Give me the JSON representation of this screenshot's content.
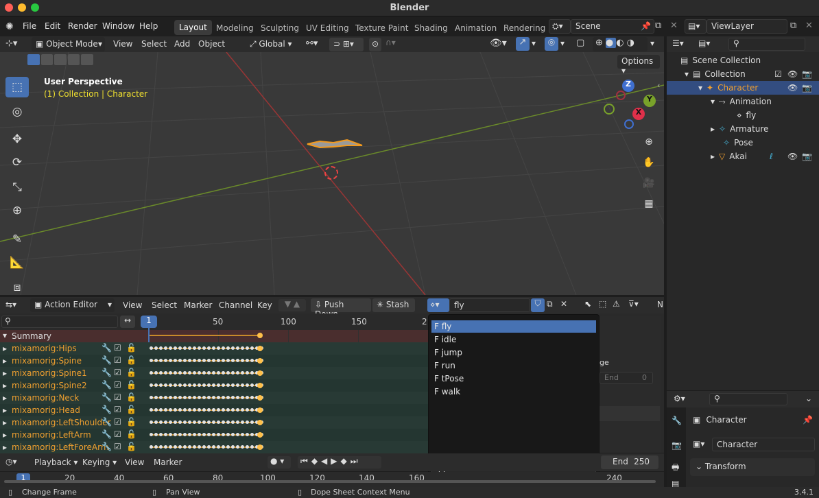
{
  "window": {
    "title": "Blender",
    "traffic": [
      "close",
      "minimize",
      "maximize"
    ]
  },
  "menubar": {
    "items": [
      "File",
      "Edit",
      "Render",
      "Window",
      "Help"
    ]
  },
  "workspaces": [
    "Layout",
    "Modeling",
    "Sculpting",
    "UV Editing",
    "Texture Paint",
    "Shading",
    "Animation",
    "Rendering"
  ],
  "scene": {
    "name": "Scene"
  },
  "viewlayer": {
    "name": "ViewLayer"
  },
  "viewport_header": {
    "mode": "Object Mode",
    "menus": [
      "View",
      "Select",
      "Add",
      "Object"
    ],
    "orientation": "Global",
    "options": "Options"
  },
  "viewport": {
    "perspective": "User Perspective",
    "context": "(1) Collection | Character",
    "gizmo": {
      "z": "Z",
      "y": "Y",
      "x": "X"
    }
  },
  "outliner": {
    "rows": [
      {
        "label": "Scene Collection"
      },
      {
        "label": "Collection"
      },
      {
        "label": "Character"
      },
      {
        "label": "Animation"
      },
      {
        "label": "fly"
      },
      {
        "label": "Armature"
      },
      {
        "label": "Pose"
      },
      {
        "label": "Akai"
      }
    ]
  },
  "action_editor": {
    "mode": "Action Editor",
    "menus": [
      "View",
      "Select",
      "Marker",
      "Channel",
      "Key"
    ],
    "push_down": "Push Down",
    "stash": "Stash",
    "action": "fly",
    "n": "N"
  },
  "dopesheet": {
    "current_frame": "1",
    "ruler": [
      "50",
      "100",
      "150",
      "2"
    ],
    "summary": "Summary",
    "channels": [
      "mixamorig:Hips",
      "mixamorig:Spine",
      "mixamorig:Spine1",
      "mixamorig:Spine2",
      "mixamorig:Neck",
      "mixamorig:Head",
      "mixamorig:LeftShoulder",
      "mixamorig:LeftArm",
      "mixamorig:LeftForeArm"
    ]
  },
  "action_dropdown": {
    "items": [
      "F fly",
      "F idle",
      "F jump",
      "F run",
      "F tPose",
      "F walk"
    ],
    "selected": "F fly",
    "search_value": ""
  },
  "hidden_panel": {
    "fragment1": "ge",
    "end_label": "End",
    "end_value": "0"
  },
  "timeline": {
    "menus": [
      "Playback",
      "Keying",
      "View",
      "Marker"
    ],
    "end_label": "End",
    "end_value": "250",
    "current": "1",
    "ruler": [
      "20",
      "40",
      "60",
      "80",
      "100",
      "120",
      "140",
      "160",
      "240"
    ]
  },
  "properties": {
    "object": "Character",
    "data": "Character",
    "section": "Transform"
  },
  "statusbar": {
    "left": "Change Frame",
    "middle": "Pan View",
    "right": "Dope Sheet Context Menu",
    "version": "3.4.1"
  },
  "colors": {
    "accent": "#4772b3",
    "orange": "#f0a030",
    "keyframe": "#ffc04a",
    "channel_bg": "#283a35",
    "summary_bg": "#4a2e2e"
  }
}
